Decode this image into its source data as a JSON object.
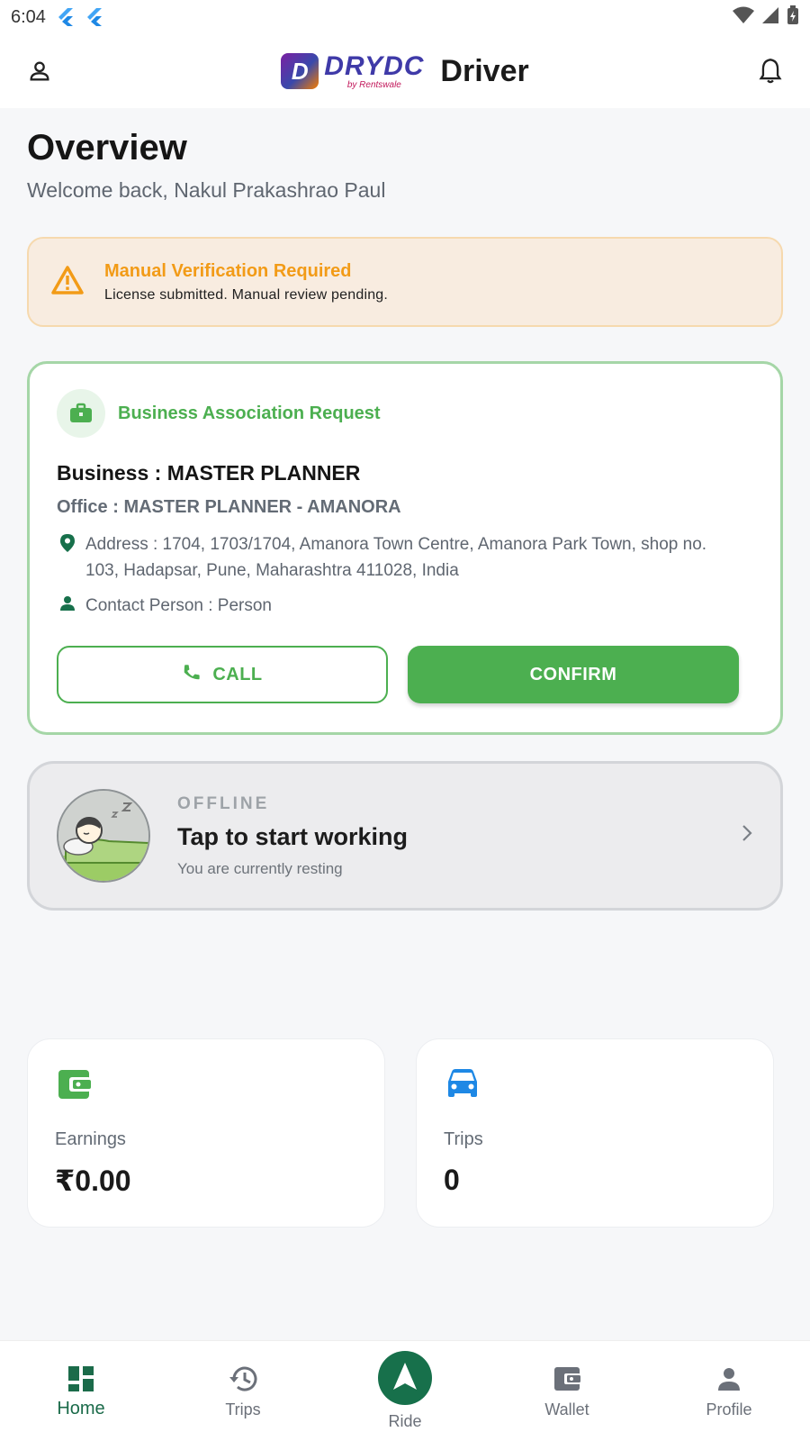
{
  "status_bar": {
    "time": "6:04"
  },
  "app_bar": {
    "logo_word": "DRYDC",
    "logo_sub": "by Rentswale",
    "title": "Driver"
  },
  "overview": {
    "title": "Overview",
    "welcome": "Welcome back, Nakul Prakashrao Paul"
  },
  "verification": {
    "title": "Manual Verification Required",
    "subtitle": "License submitted. Manual review pending.",
    "color": "#f29b17"
  },
  "business_request": {
    "header": "Business Association Request",
    "business": "Business : MASTER PLANNER",
    "office": "Office : MASTER PLANNER - AMANORA",
    "address": "Address : 1704, 1703/1704, Amanora Town Centre, Amanora Park Town, shop no. 103, Hadapsar, Pune, Maharashtra 411028, India",
    "contact": "Contact Person : Person",
    "call_label": "CALL",
    "confirm_label": "CONFIRM",
    "accent_color": "#4caf50"
  },
  "status_card": {
    "tag": "OFFLINE",
    "title": "Tap to start working",
    "subtitle": "You are currently resting"
  },
  "stats": [
    {
      "label": "Earnings",
      "value": "₹0.00",
      "icon": "wallet-icon"
    },
    {
      "label": "Trips",
      "value": "0",
      "icon": "car-icon"
    }
  ],
  "bottom_nav": {
    "items": [
      {
        "label": "Home",
        "icon": "dashboard-icon",
        "active": true
      },
      {
        "label": "Trips",
        "icon": "history-icon"
      },
      {
        "label": "Ride",
        "icon": "navigation-icon"
      },
      {
        "label": "Wallet",
        "icon": "wallet-icon"
      },
      {
        "label": "Profile",
        "icon": "person-icon"
      }
    ],
    "active_color": "#1b6b4a"
  }
}
